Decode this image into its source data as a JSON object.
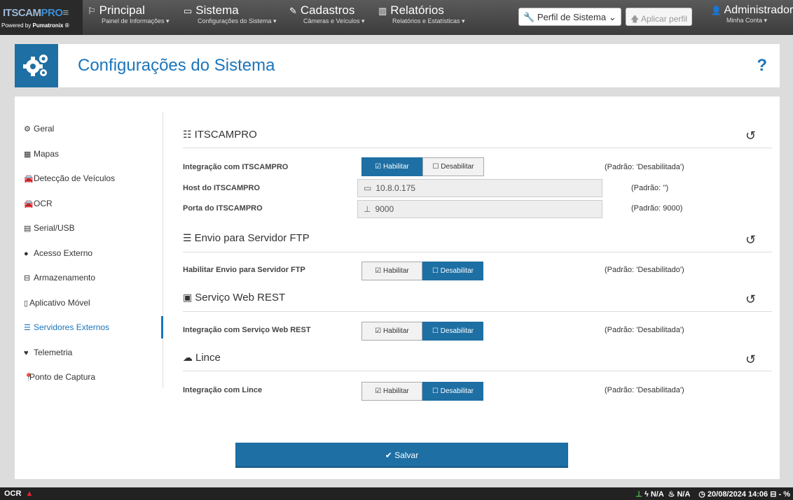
{
  "logo": {
    "brand_a": "ITSCAM",
    "brand_b": "PRO",
    "powered": "Powered by",
    "company": "Pumatronix ®"
  },
  "nav": [
    {
      "title": "Principal",
      "sub": "Painel de Informações ▾",
      "icon": "flag-icon"
    },
    {
      "title": "Sistema",
      "sub": "Configurações do Sistema ▾",
      "icon": "monitor-icon"
    },
    {
      "title": "Cadastros",
      "sub": "Câmeras e Veículos ▾",
      "icon": "edit-icon"
    },
    {
      "title": "Relatórios",
      "sub": "Relatórios e Estatísticas ▾",
      "icon": "bar-chart-icon"
    }
  ],
  "profile": {
    "selected": "Perfil de Sistema",
    "apply": "Aplicar perfil"
  },
  "account": {
    "name": "Administrador",
    "sub": "Minha Conta ▾"
  },
  "page": {
    "title": "Configurações do Sistema",
    "help": "?"
  },
  "sidebar": {
    "active": "Servidores Externos",
    "items": [
      {
        "label": "Geral",
        "icon": "gears-icon"
      },
      {
        "label": "Mapas",
        "icon": "map-icon"
      },
      {
        "label": "Detecção de Veículos",
        "icon": "car-icon"
      },
      {
        "label": "OCR",
        "icon": "car-icon"
      },
      {
        "label": "Serial/USB",
        "icon": "serial-icon"
      },
      {
        "label": "Acesso Externo",
        "icon": "globe-icon"
      },
      {
        "label": "Armazenamento",
        "icon": "hdd-icon"
      },
      {
        "label": "Aplicativo Móvel",
        "icon": "mobile-icon"
      },
      {
        "label": "Servidores Externos",
        "icon": "server-icon"
      },
      {
        "label": "Telemetria",
        "icon": "heartbeat-icon"
      },
      {
        "label": "Ponto de Captura",
        "icon": "map-pin-icon"
      }
    ]
  },
  "sections": {
    "itscampro": {
      "title": "ITSCAMPRO",
      "rows": [
        {
          "label": "Integração com ITSCAMPRO",
          "enable": "Habilitar",
          "disable": "Desabilitar",
          "selected": "Habilitar",
          "default": "(Padrão: 'Desabilitada')"
        },
        {
          "label": "Host do ITSCAMPRO",
          "value": "10.8.0.175",
          "default": "(Padrão: '')"
        },
        {
          "label": "Porta do ITSCAMPRO",
          "value": "9000",
          "default": "(Padrão: 9000)"
        }
      ]
    },
    "ftp": {
      "title": "Envio para Servidor FTP",
      "label": "Habilitar Envio para Servidor FTP",
      "enable": "Habilitar",
      "disable": "Desabilitar",
      "selected": "Desabilitar",
      "default": "(Padrão: 'Desabilitado')"
    },
    "rest": {
      "title": "Serviço Web REST",
      "label": "Integração com Serviço Web REST",
      "enable": "Habilitar",
      "disable": "Desabilitar",
      "selected": "Desabilitar",
      "default": "(Padrão: 'Desabilitada')"
    },
    "lince": {
      "title": "Lince",
      "label": "Integração com Lince",
      "enable": "Habilitar",
      "disable": "Desabilitar",
      "selected": "Desabilitar",
      "default": "(Padrão: 'Desabilitada')"
    }
  },
  "save": "Salvar",
  "status": {
    "ocr": "OCR",
    "na1": "N/A",
    "na2": "N/A",
    "datetime": "20/08/2024 14:06",
    "disk": "- %"
  },
  "colors": {
    "accent": "#1e6fa3",
    "title": "#1b75bb"
  }
}
